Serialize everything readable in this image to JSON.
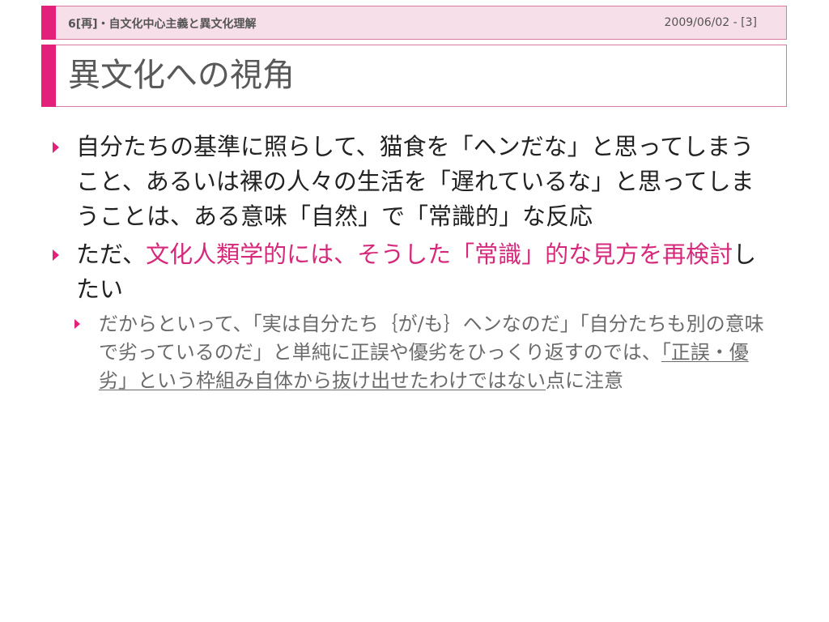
{
  "header": {
    "title": "6[再]・自文化中心主義と異文化理解",
    "date": "2009/06/02 - [3]"
  },
  "slide": {
    "title": "異文化への視角"
  },
  "bullets": {
    "b1": "自分たちの基準に照らして、猫食を「ヘンだな」と思ってしまうこと、あるいは裸の人々の生活を「遅れているな」と思ってしまうことは、ある意味「自然」で「常識的」な反応",
    "b2_prefix": "ただ、",
    "b2_highlight": "文化人類学的には、そうした「常識」的な見方を再検討",
    "b2_suffix": "したい",
    "sub1_prefix": "だからといって、「実は自分たち｛が/も｝ヘンなのだ」「自分たちも別の意味で劣っているのだ」と単純に正誤や優劣をひっくり返すのでは、",
    "sub1_underlined": "「正誤・優劣」という枠組み自体から抜け出せたわけではない",
    "sub1_suffix": "点に注意"
  },
  "colors": {
    "accent": "#e3207a",
    "header_bg": "#f6dfe8",
    "highlight_text": "#d7297c"
  }
}
